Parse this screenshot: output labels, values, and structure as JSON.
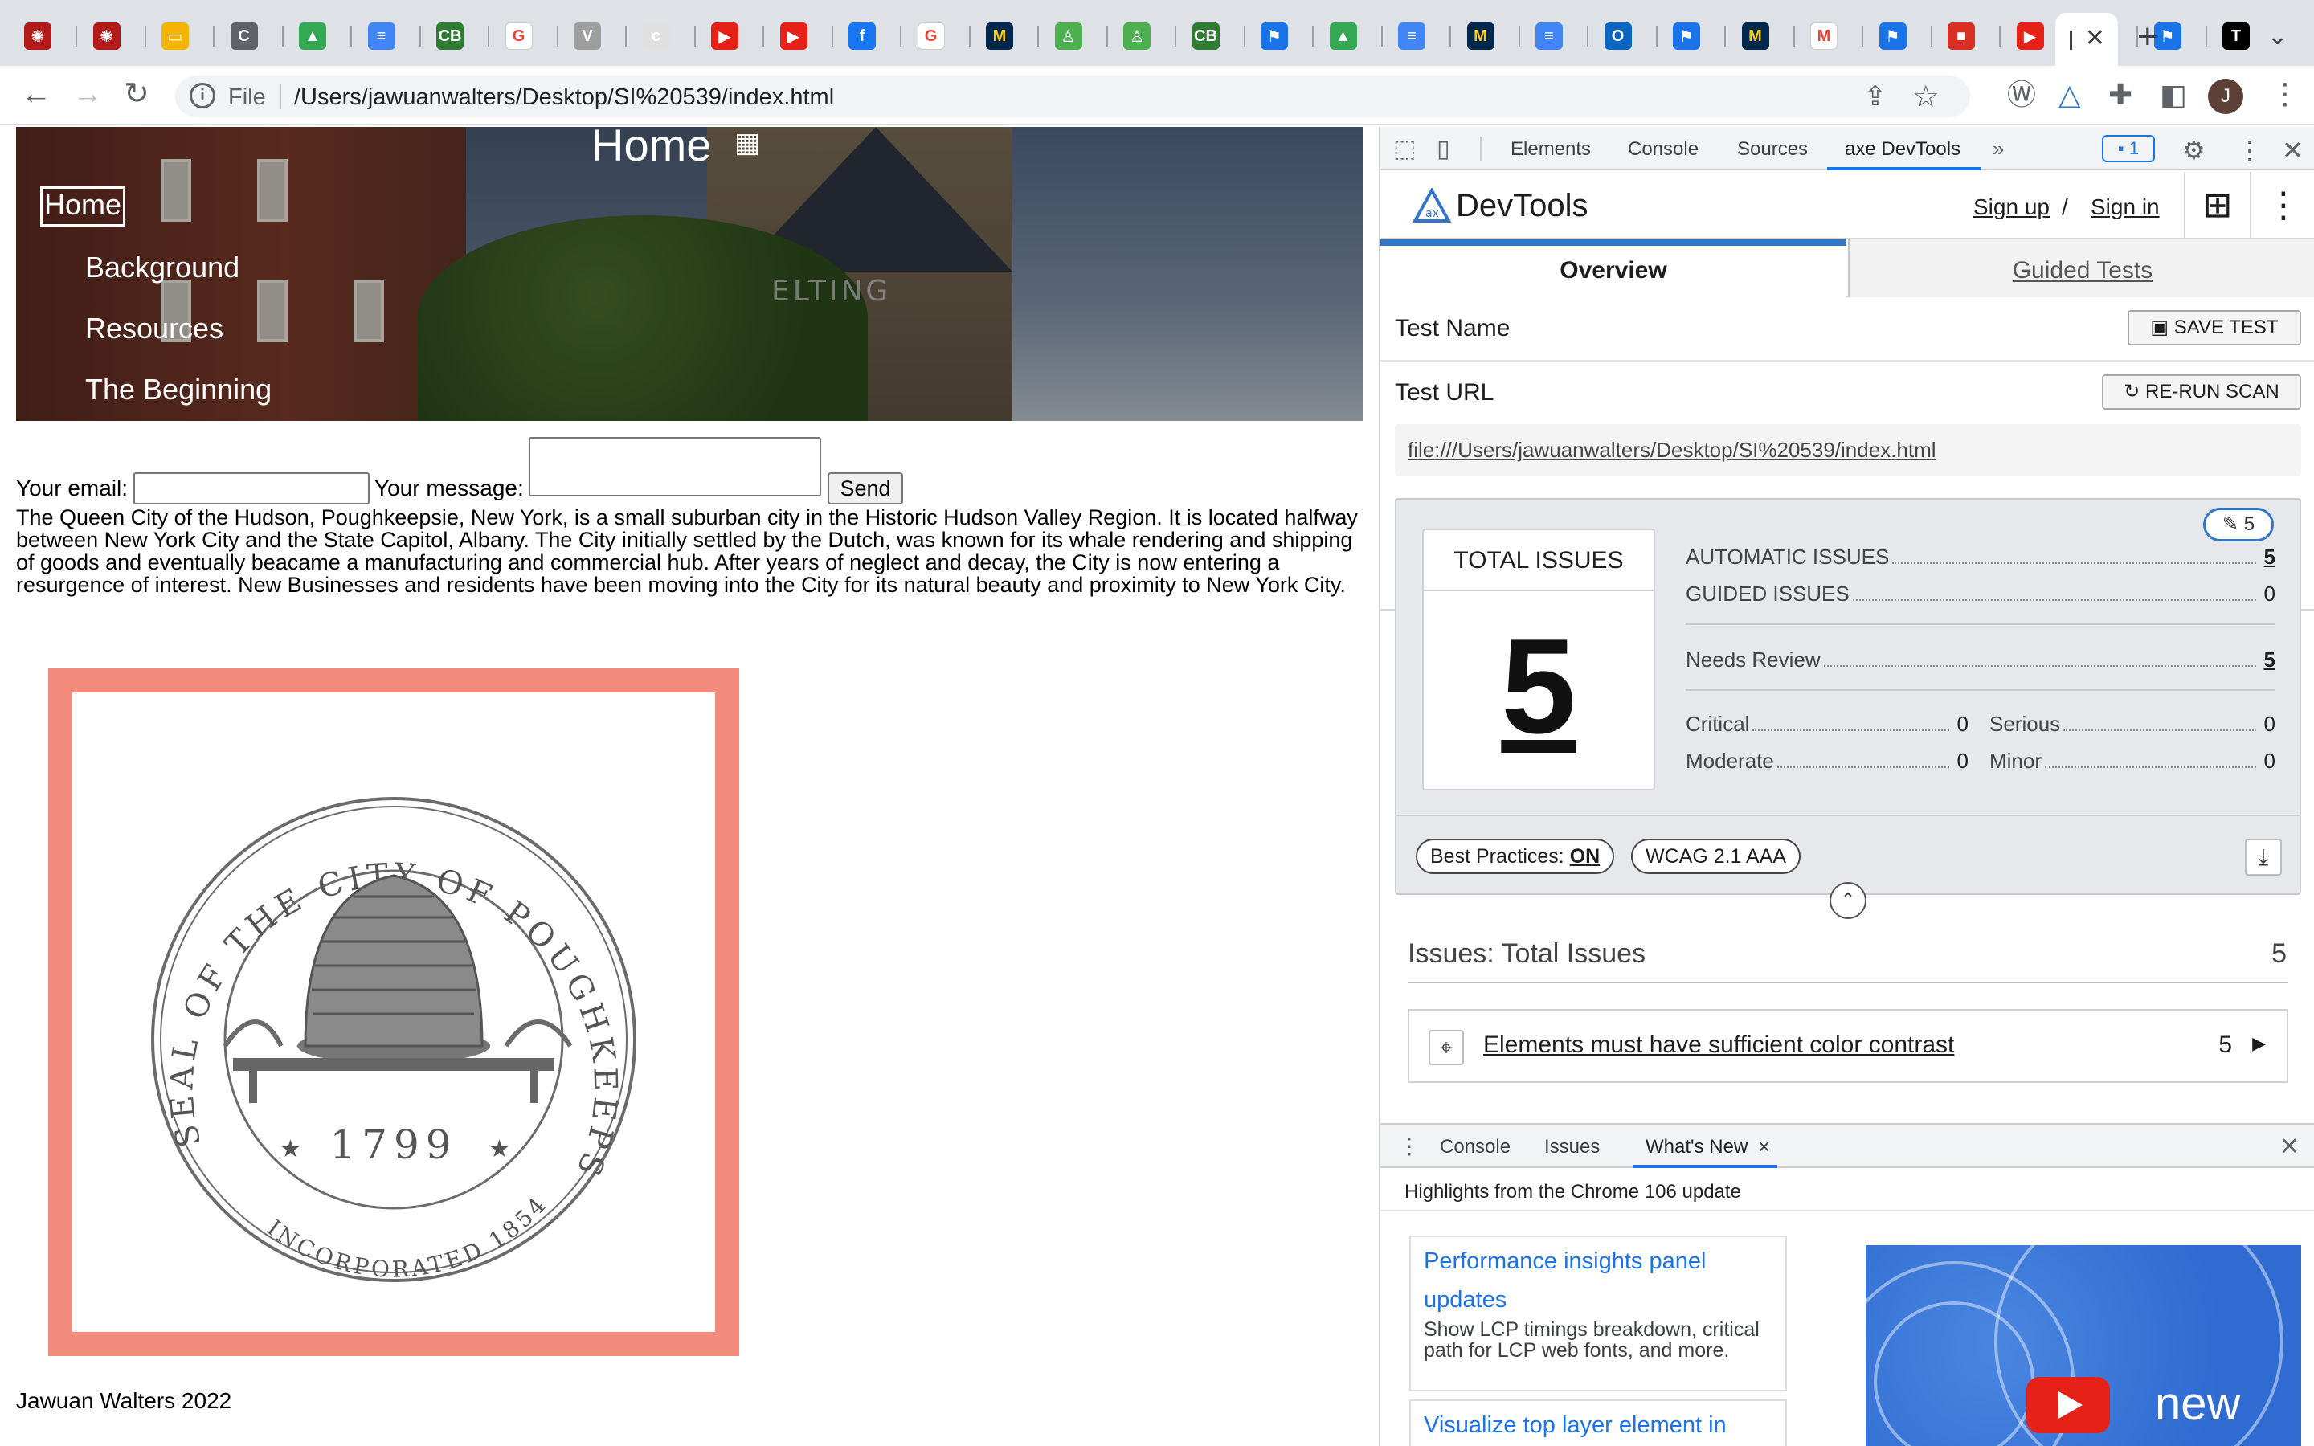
{
  "browser": {
    "address": {
      "scheme_label": "File",
      "url": "/Users/jawuanwalters/Desktop/SI%20539/index.html"
    },
    "tab_icons": [
      "cornell-icon",
      "cornell-icon",
      "slides-icon",
      "classroom-icon",
      "drive-icon",
      "docs-icon",
      "cb-icon",
      "google-icon",
      "vanderbilt-icon",
      "csis-icon",
      "youtube-icon",
      "youtube-icon",
      "facebook-icon",
      "google-icon",
      "michigan-icon",
      "statue-icon",
      "statue-icon",
      "cb-icon",
      "flag-icon",
      "drive-icon",
      "docs-icon",
      "michigan-icon",
      "docs-icon",
      "outlook-icon",
      "flag-icon",
      "michigan-icon",
      "gmail-icon",
      "flag-icon",
      "bag-icon",
      "youtube-icon",
      "slack-icon",
      "flag-icon",
      "nyt-icon"
    ],
    "avatar_initial": "J"
  },
  "page": {
    "hero": {
      "title": "Home",
      "sign_text": "ELTING",
      "nav": [
        "Home",
        "Background",
        "Resources",
        "The Beginning"
      ]
    },
    "form": {
      "email_label": "Your email:",
      "message_label": "Your message:",
      "send_label": "Send"
    },
    "paragraph": "The Queen City of the Hudson, Poughkeepsie, New York, is a small suburban city in the Historic Hudson Valley Region. It is located halfway between New York City and the State Capitol, Albany. The City initially settled by the Dutch, was known for its whale rendering and shipping of goods and eventually beacame a manufacturing and commercial hub. After years of neglect and decay, the City is now entering a resurgence of interest. New Businesses and residents have been moving into the City for its natural beauty and proximity to New York City.",
    "seal": {
      "ring_text": "SEAL OF THE CITY OF POUGHKEEPSIE",
      "year": "1799",
      "incorporated": "INCORPORATED 1854"
    },
    "footer": "Jawuan Walters 2022"
  },
  "devtools": {
    "tabs": [
      "Elements",
      "Console",
      "Sources",
      "axe DevTools"
    ],
    "issues_badge": "1",
    "axe": {
      "title": "DevTools",
      "sign_up": "Sign up",
      "slash": "/",
      "sign_in": "Sign in",
      "tabs": {
        "overview": "Overview",
        "guided": "Guided Tests"
      },
      "test_name_label": "Test Name",
      "save_label": "SAVE TEST",
      "test_url_label": "Test URL",
      "rerun_label": "RE-RUN SCAN",
      "test_url": "file:///Users/jawuanwalters/Desktop/SI%20539/index.html",
      "pill_count": "5",
      "total_caption": "TOTAL ISSUES",
      "total_value": "5",
      "stats": {
        "automatic_label": "AUTOMATIC ISSUES",
        "automatic": "5",
        "guided_label": "GUIDED ISSUES",
        "guided": "0",
        "needs_review_label": "Needs Review",
        "needs_review": "5",
        "critical_label": "Critical",
        "critical": "0",
        "serious_label": "Serious",
        "serious": "0",
        "moderate_label": "Moderate",
        "moderate": "0",
        "minor_label": "Minor",
        "minor": "0"
      },
      "best_practices_label": "Best Practices:",
      "best_practices_value": "ON",
      "standard": "WCAG 2.1 AAA",
      "issues_title": "Issues: Total Issues",
      "issues_count": "5",
      "issue": {
        "text": "Elements must have sufficient color contrast",
        "count": "5"
      }
    },
    "drawer": {
      "tabs": [
        "Console",
        "Issues",
        "What's New"
      ],
      "close_glyph": "×",
      "whats_new_heading": "Highlights from the Chrome 106 update",
      "cards": [
        {
          "title": "Performance insights panel updates",
          "desc": "Show LCP timings breakdown, critical path for LCP web fonts, and more."
        },
        {
          "title": "Visualize top layer element in",
          "desc": ""
        }
      ],
      "video_label": "new"
    }
  },
  "colors": {
    "accent": "#1a73e8",
    "seal_border": "#f28b7c",
    "axe_blue": "#3276c8"
  }
}
